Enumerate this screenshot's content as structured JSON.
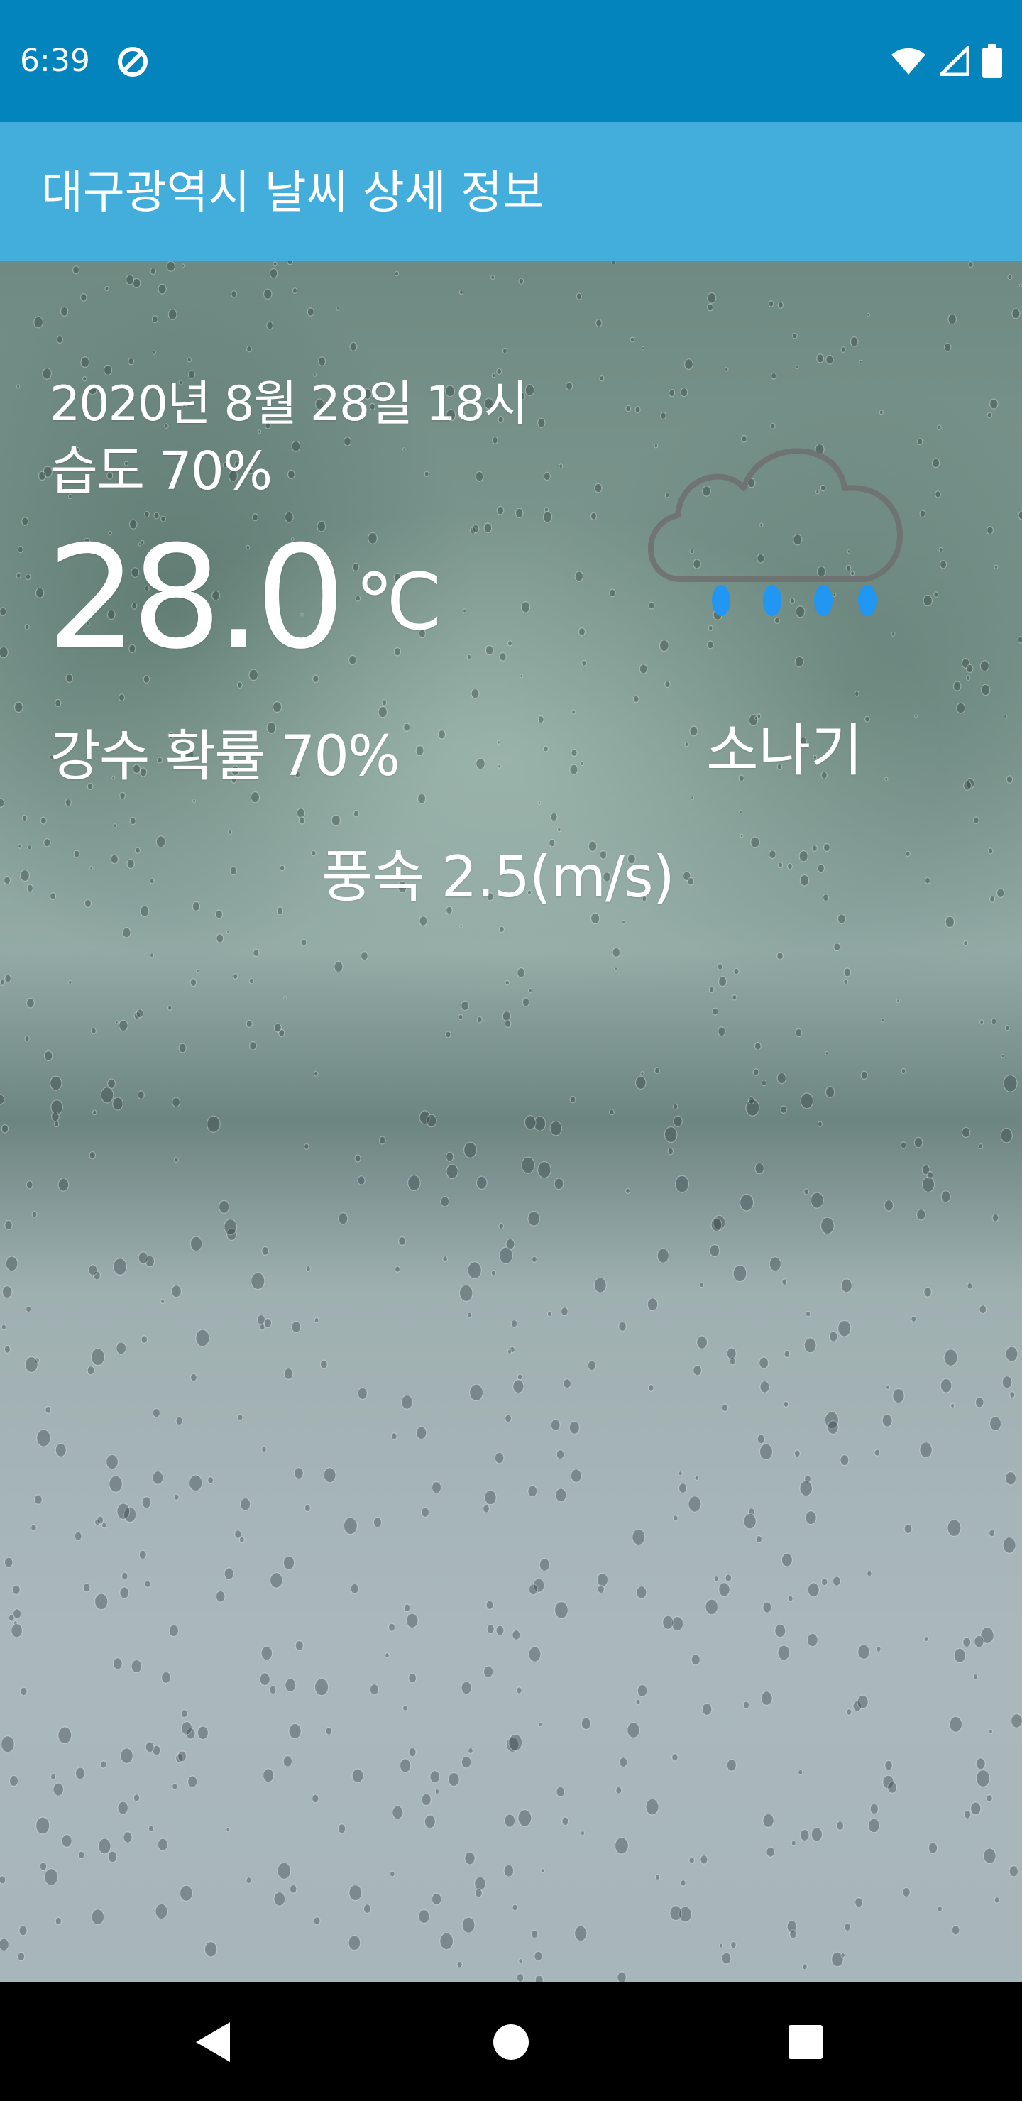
{
  "status_bar": {
    "time": "6:39",
    "icons": [
      "app-notification-icon",
      "wifi-icon",
      "cell-signal-icon",
      "battery-icon"
    ]
  },
  "app_bar": {
    "title": "대구광역시 날씨 상세 정보"
  },
  "weather": {
    "datetime": "2020년 8월 28일 18시",
    "humidity": "습도 70%",
    "temperature": "28.0",
    "temperature_unit": "℃",
    "rain_probability": "강수 확률 70%",
    "condition": "소나기",
    "wind_speed": "풍속 2.5(m/s)",
    "icon": "rain-cloud-icon"
  },
  "nav_bar": {
    "buttons": [
      "back-icon",
      "home-icon",
      "recents-icon"
    ]
  },
  "colors": {
    "status_bar": "#0384BD",
    "app_bar": "#43AEDC",
    "rain_drop": "#2196F3",
    "cloud_outline": "#6E6E6E"
  }
}
